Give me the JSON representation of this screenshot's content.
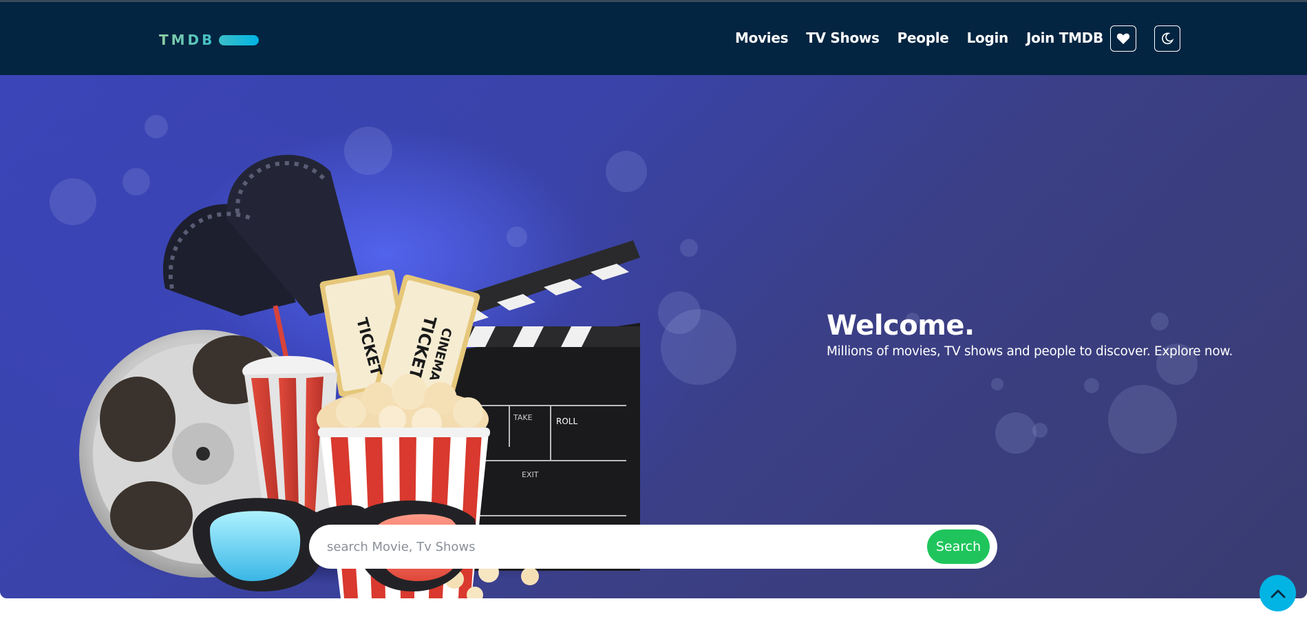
{
  "navbar": {
    "logo_text": "TMDB",
    "links": [
      "Movies",
      "TV Shows",
      "People",
      "Login",
      "Join TMDB"
    ],
    "favorites_icon": "heart-icon",
    "theme_icon": "moon-icon"
  },
  "hero": {
    "title": "Welcome.",
    "subtitle": "Millions of movies, TV shows and people to discover. Explore now.",
    "illustration_labels": [
      "CINEMA",
      "TICKET",
      "TICKET",
      "TAKE",
      "ROLL",
      "EXIT"
    ]
  },
  "search": {
    "placeholder": "search Movie, Tv Shows",
    "value": "",
    "button_label": "Search"
  },
  "scroll_top": {
    "icon": "chevron-up-icon"
  },
  "colors": {
    "navbar_bg": "#032541",
    "search_button": "#1fc55c",
    "scroll_top": "#01b4e4",
    "logo_accent": "#3cbec9"
  }
}
